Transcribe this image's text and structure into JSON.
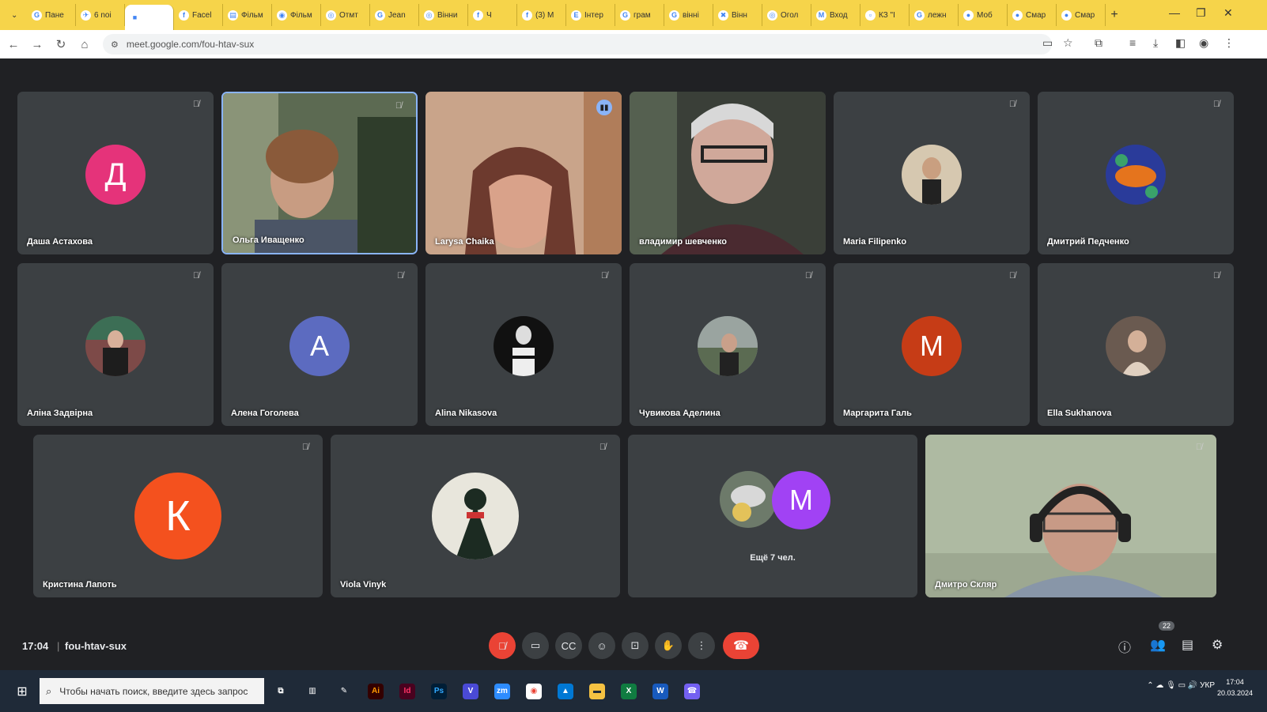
{
  "browser": {
    "tabs": [
      {
        "icon": "G",
        "label": "Пане"
      },
      {
        "icon": "✈",
        "label": "6 noi"
      },
      {
        "icon": "■",
        "label": ""
      },
      {
        "icon": "f",
        "label": "Facel"
      },
      {
        "icon": "▤",
        "label": "Фільм"
      },
      {
        "icon": "◉",
        "label": "Фільм"
      },
      {
        "icon": "◎",
        "label": "Отмт"
      },
      {
        "icon": "G",
        "label": "Jean"
      },
      {
        "icon": "◎",
        "label": "Вінни"
      },
      {
        "icon": "f",
        "label": "Ч"
      },
      {
        "icon": "f",
        "label": "(3) M"
      },
      {
        "icon": "E",
        "label": "Інтер"
      },
      {
        "icon": "G",
        "label": "грам"
      },
      {
        "icon": "G",
        "label": "вінні"
      },
      {
        "icon": "✖",
        "label": "Вінн"
      },
      {
        "icon": "◎",
        "label": "Огол"
      },
      {
        "icon": "M",
        "label": "Вход"
      },
      {
        "icon": "▫",
        "label": "КЗ \"І"
      },
      {
        "icon": "G",
        "label": "лежн"
      },
      {
        "icon": "●",
        "label": "Моб"
      },
      {
        "icon": "●",
        "label": "Смар"
      },
      {
        "icon": "●",
        "label": "Смар"
      }
    ],
    "new_tab": "+",
    "url": "meet.google.com/fou-htav-sux"
  },
  "participants": [
    {
      "name": "Даша Астахова",
      "initial": "Д",
      "color": "#e5337a"
    },
    {
      "name": "Ольга Иващенко"
    },
    {
      "name": "Larysa Chaika"
    },
    {
      "name": "владимир шевченко"
    },
    {
      "name": "Maria Filipenko"
    },
    {
      "name": "Дмитрий Педченко"
    },
    {
      "name": "Аліна Задвірна"
    },
    {
      "name": "Алена Гоголева",
      "initial": "А",
      "color": "#5c6bc0"
    },
    {
      "name": "Alina Nikasova"
    },
    {
      "name": "Чувикова Аделина"
    },
    {
      "name": "Маргарита Галь",
      "initial": "М",
      "color": "#c63c16"
    },
    {
      "name": "Ella Sukhanova"
    },
    {
      "name": "Кристина Лапоть",
      "initial": "К",
      "color": "#f4511e"
    },
    {
      "name": "Viola Vinyk"
    },
    {
      "name": "Дмитро Скляр"
    }
  ],
  "others": {
    "initial": "М",
    "color": "#a142f4",
    "label": "Ещё 7 чел."
  },
  "controls": {
    "time": "17:04",
    "separator": "|",
    "meeting_code": "fou-htav-sux",
    "people_count": "22"
  },
  "taskbar": {
    "search_placeholder": "Чтобы начать поиск, введите здесь запрос",
    "apps": [
      {
        "label": "Ai",
        "color": "#330000",
        "fg": "#ff9a00"
      },
      {
        "label": "Id",
        "color": "#49021f",
        "fg": "#ff3366"
      },
      {
        "label": "Ps",
        "color": "#001e36",
        "fg": "#31a8ff"
      },
      {
        "label": "V",
        "color": "#4a4ad6",
        "fg": "#fff"
      },
      {
        "label": "zm",
        "color": "#2d8cff",
        "fg": "#fff"
      },
      {
        "label": "◉",
        "color": "#ffffff",
        "fg": "#ea4335"
      },
      {
        "label": "▲",
        "color": "#0078d4",
        "fg": "#fff"
      },
      {
        "label": "▬",
        "color": "#f5c242",
        "fg": "#1f2a38"
      },
      {
        "label": "X",
        "color": "#107c41",
        "fg": "#fff"
      },
      {
        "label": "W",
        "color": "#185abd",
        "fg": "#fff"
      },
      {
        "label": "☎",
        "color": "#7360f2",
        "fg": "#fff"
      }
    ],
    "lang": "УКР",
    "time": "17:04",
    "date": "20.03.2024"
  }
}
